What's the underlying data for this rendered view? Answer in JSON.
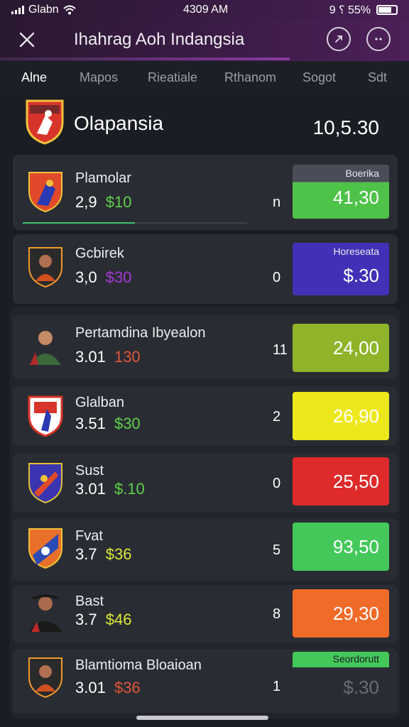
{
  "status_bar": {
    "carrier": "Glabn",
    "time": "4309 AM",
    "icons_right": "9 ⸮ 55%"
  },
  "header": {
    "title": "Ihahrag Aoh Indangsia",
    "close_icon": "close-icon",
    "share_icon": "share-icon",
    "more_icon": "more-icon"
  },
  "tabs": [
    "Alne",
    "Mapos",
    "Rieatiale",
    "Rthanom",
    "Sogot",
    "Sdt"
  ],
  "match": {
    "name": "Olapansia",
    "score": "10,5.30"
  },
  "items": [
    {
      "name": "Plamolar",
      "odds_base": "2,9",
      "odds_alt": "$10",
      "alt_color": "#5fd04a",
      "count": "n",
      "price": "41,30",
      "label": "Boerika",
      "box_color": "#4fc24a",
      "logo": "crest-red-blue"
    },
    {
      "name": "Gcbirek",
      "odds_base": "3,0",
      "odds_alt": "$30",
      "alt_color": "#a63ad6",
      "count": "0",
      "price": "$.30",
      "label": "Horeseata",
      "box_color": "#4131b6",
      "logo": "crest-dark-player"
    },
    {
      "name": "Pertamdina Ibyealon",
      "odds_base": "3.01",
      "odds_alt": "130",
      "alt_color": "#e0563a",
      "count": "11",
      "price": "24,00",
      "label": "",
      "box_color": "#8fb42a",
      "logo": "player-avatar"
    },
    {
      "name": "Glalban",
      "odds_base": "3.51",
      "odds_alt": "$30",
      "alt_color": "#5fd04a",
      "count": "2",
      "price": "26,90",
      "label": "",
      "box_color": "#ece81c",
      "logo": "crest-red-white"
    },
    {
      "name": "Sust",
      "odds_base": "3.01",
      "odds_alt": "$.10",
      "alt_color": "#5fd04a",
      "count": "0",
      "price": "25,50",
      "label": "",
      "box_color": "#de2a2a",
      "logo": "crest-blue-red"
    },
    {
      "name": "Fvat",
      "odds_base": "3.7",
      "odds_alt": "$36",
      "alt_color": "#d9e83a",
      "count": "5",
      "price": "93,50",
      "label": "",
      "box_color": "#44c85a",
      "logo": "crest-orange-blue"
    },
    {
      "name": "Bast",
      "odds_base": "3.7",
      "odds_alt": "$46",
      "alt_color": "#d9e83a",
      "count": "8",
      "price": "29,30",
      "label": "",
      "box_color": "#f06a28",
      "logo": "player-avatar-2"
    },
    {
      "name": "Blamtioma Bloaioan",
      "odds_base": "3.01",
      "odds_alt": "$36",
      "alt_color": "#e0563a",
      "count": "1",
      "price": "$.30",
      "label": "Seordorutt",
      "box_color": "#2a2c33",
      "logo": "crest-dark-player-2"
    }
  ],
  "colors": {
    "accent_purple": "#8a3aa0",
    "background": "#1b1d24",
    "card": "#2a2c33"
  }
}
